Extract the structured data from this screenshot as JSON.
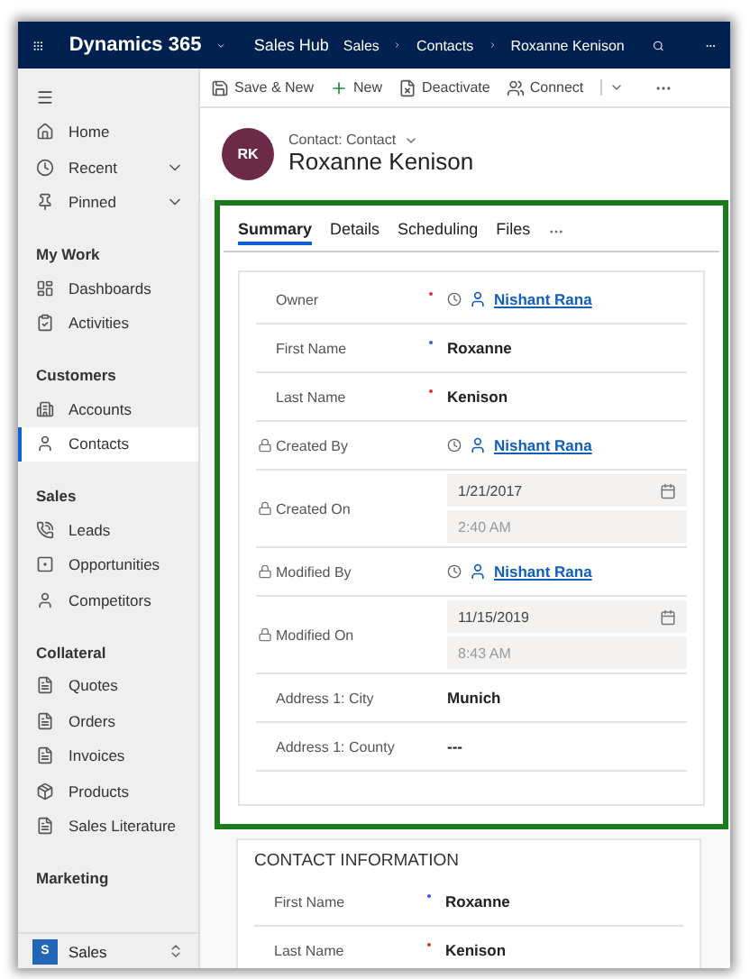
{
  "app_bar": {
    "app_name": "Dynamics 365",
    "hub": "Sales Hub",
    "breadcrumb": [
      "Sales",
      "Contacts",
      "Roxanne Kenison"
    ]
  },
  "commands": [
    "Save & New",
    "New",
    "Deactivate",
    "Connect"
  ],
  "sidebar": {
    "top_items": [
      {
        "label": "Home",
        "expandable": false
      },
      {
        "label": "Recent",
        "expandable": true
      },
      {
        "label": "Pinned",
        "expandable": true
      }
    ],
    "groups": [
      {
        "title": "My Work",
        "items": [
          {
            "label": "Dashboards",
            "selected": false
          },
          {
            "label": "Activities",
            "selected": false
          }
        ]
      },
      {
        "title": "Customers",
        "items": [
          {
            "label": "Accounts",
            "selected": false
          },
          {
            "label": "Contacts",
            "selected": true
          }
        ]
      },
      {
        "title": "Sales",
        "items": [
          {
            "label": "Leads",
            "selected": false
          },
          {
            "label": "Opportunities",
            "selected": false
          },
          {
            "label": "Competitors",
            "selected": false
          }
        ]
      },
      {
        "title": "Collateral",
        "items": [
          {
            "label": "Quotes",
            "selected": false
          },
          {
            "label": "Orders",
            "selected": false
          },
          {
            "label": "Invoices",
            "selected": false
          },
          {
            "label": "Products",
            "selected": false
          },
          {
            "label": "Sales Literature",
            "selected": false
          }
        ]
      },
      {
        "title": "Marketing"
      }
    ],
    "area": {
      "initials": "S",
      "label": "Sales"
    }
  },
  "header": {
    "initials": "RK",
    "entity": "Contact: Contact",
    "name": "Roxanne Kenison"
  },
  "tabs": [
    {
      "label": "Summary",
      "selected": true
    },
    {
      "label": "Details",
      "selected": false
    },
    {
      "label": "Scheduling",
      "selected": false
    },
    {
      "label": "Files",
      "selected": false
    }
  ],
  "summary_fields": [
    {
      "label": "Owner",
      "kind": "lookup",
      "locked": false,
      "required": true,
      "recommended": false,
      "value": "Nishant Rana"
    },
    {
      "label": "First Name",
      "kind": "text",
      "locked": false,
      "required": false,
      "recommended": true,
      "value": "Roxanne"
    },
    {
      "label": "Last Name",
      "kind": "text",
      "locked": false,
      "required": true,
      "recommended": false,
      "value": "Kenison"
    },
    {
      "label": "Created By",
      "kind": "lookup",
      "locked": true,
      "required": false,
      "recommended": false,
      "value": "Nishant Rana"
    },
    {
      "label": "Created On",
      "kind": "datetime",
      "locked": true,
      "required": false,
      "recommended": false,
      "date": "1/21/2017",
      "time": "2:40 AM"
    },
    {
      "label": "Modified By",
      "kind": "lookup",
      "locked": true,
      "required": false,
      "recommended": false,
      "value": "Nishant Rana"
    },
    {
      "label": "Modified On",
      "kind": "datetime",
      "locked": true,
      "required": false,
      "recommended": false,
      "date": "11/15/2019",
      "time": "8:43 AM"
    },
    {
      "label": "Address 1: City",
      "kind": "text",
      "locked": false,
      "required": false,
      "recommended": false,
      "value": "Munich"
    },
    {
      "label": "Address 1: County",
      "kind": "text",
      "locked": false,
      "required": false,
      "recommended": false,
      "value": "---"
    }
  ],
  "contact_information": {
    "title": "CONTACT INFORMATION",
    "fields": [
      {
        "label": "First Name",
        "kind": "text",
        "locked": false,
        "required": false,
        "recommended": true,
        "value": "Roxanne"
      },
      {
        "label": "Last Name",
        "kind": "text",
        "locked": false,
        "required": true,
        "recommended": false,
        "value": "Kenison"
      }
    ]
  }
}
